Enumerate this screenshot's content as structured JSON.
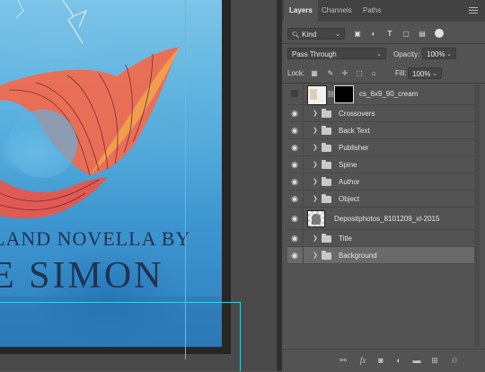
{
  "panel": {
    "tabs": [
      {
        "label": "Layers",
        "active": true
      },
      {
        "label": "Channels",
        "active": false
      },
      {
        "label": "Paths",
        "active": false
      }
    ],
    "filter": {
      "kind": "Kind"
    },
    "blend": {
      "mode": "Pass Through",
      "opacity_label": "Opacity:",
      "opacity_value": "100%"
    },
    "lock": {
      "label": "Lock:",
      "fill_label": "Fill:",
      "fill_value": "100%"
    },
    "layers": [
      {
        "name": "cs_6x9_90_cream",
        "type": "smart-with-mask",
        "visible": false,
        "selected": false
      },
      {
        "name": "Crossovers",
        "type": "group",
        "visible": true,
        "selected": false
      },
      {
        "name": "Back Text",
        "type": "group",
        "visible": true,
        "selected": false
      },
      {
        "name": "Publisher",
        "type": "group",
        "visible": true,
        "selected": false
      },
      {
        "name": "Spine",
        "type": "group",
        "visible": true,
        "selected": false
      },
      {
        "name": "Author",
        "type": "group",
        "visible": true,
        "selected": false
      },
      {
        "name": "Object",
        "type": "group",
        "visible": true,
        "selected": false
      },
      {
        "name": "Depositphotos_8101209_xl-2015",
        "type": "pixel",
        "visible": true,
        "selected": false
      },
      {
        "name": "Title",
        "type": "group",
        "visible": true,
        "selected": false
      },
      {
        "name": "Background",
        "type": "group",
        "visible": true,
        "selected": true
      }
    ]
  },
  "canvas": {
    "line1": "LAND NOVELLA BY",
    "line2": "E SIMON"
  },
  "colors": {
    "panel_bg": "#535353",
    "selected_layer": "#6a6a6a",
    "guide": "#34d0e8",
    "ocean": "#4aa3d8",
    "title_ink": "#1f3352"
  }
}
